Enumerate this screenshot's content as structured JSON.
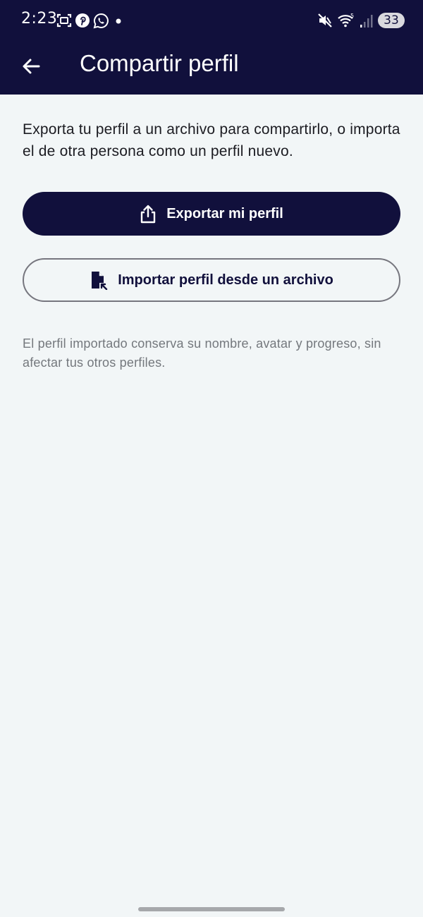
{
  "status_bar": {
    "time": "2:23",
    "battery_level": "33",
    "notification_icons": [
      "screenshot-icon",
      "pinterest-icon",
      "whatsapp-icon",
      "dot-icon"
    ],
    "system_icons": [
      "mute-icon",
      "wifi-icon",
      "signal-icon"
    ]
  },
  "app_bar": {
    "title": "Compartir perfil",
    "back_icon": "arrow-left-icon"
  },
  "main": {
    "description": "Exporta tu perfil a un archivo para compartirlo, o importa el de otra persona como un perfil nuevo.",
    "export_button": {
      "label": "Exportar mi perfil",
      "icon": "share-upload-icon"
    },
    "import_button": {
      "label": "Importar perfil desde un archivo",
      "icon": "file-import-icon"
    },
    "hint": "El perfil importado conserva su nombre, avatar y progreso, sin afectar tus otros perfiles."
  },
  "colors": {
    "primary": "#11103c",
    "background": "#f2f6f7",
    "text": "#1c1c22",
    "hint_text": "#74787d",
    "outline": "#76767e"
  }
}
